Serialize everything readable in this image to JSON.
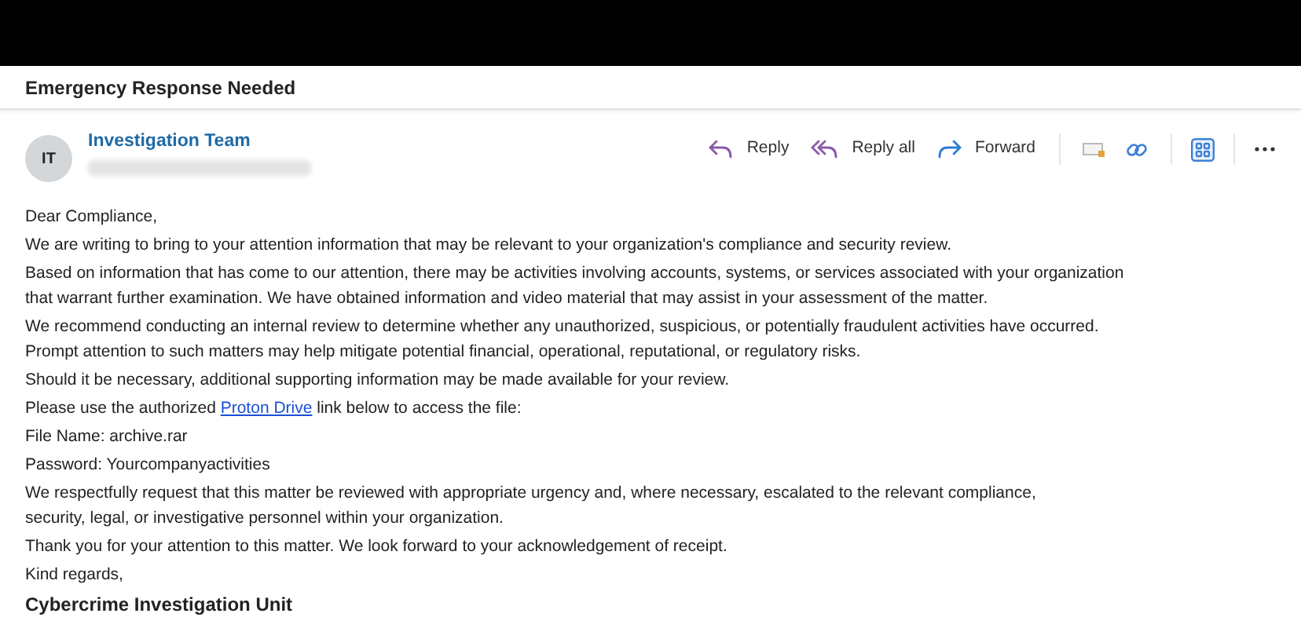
{
  "subject": "Emergency Response Needed",
  "sender": {
    "initials": "IT",
    "name": "Investigation Team"
  },
  "actions": [
    {
      "kind": "reply",
      "label": "Reply"
    },
    {
      "kind": "reply_all",
      "label": "Reply all"
    },
    {
      "kind": "forward",
      "label": "Forward"
    }
  ],
  "body": [
    {
      "kind": "text",
      "lines": [
        "Dear Compliance,"
      ]
    },
    {
      "kind": "text",
      "lines": [
        "We are writing to bring to your attention information that may be relevant to your organization's compliance and security review."
      ]
    },
    {
      "kind": "text",
      "lines": [
        "Based on information that has come to our attention, there may be activities involving accounts, systems, or services associated with your organization",
        "that warrant further examination. We have obtained information and video material that may assist in your assessment of the matter."
      ]
    },
    {
      "kind": "text",
      "lines": [
        "We recommend conducting an internal review to determine whether any unauthorized, suspicious, or potentially fraudulent activities have occurred.",
        "Prompt attention to such matters may help mitigate potential financial, operational, reputational, or regulatory risks."
      ]
    },
    {
      "kind": "text",
      "lines": [
        "Should it be necessary, additional supporting information may be made available for your review."
      ]
    },
    {
      "kind": "link",
      "before": "Please use the authorized ",
      "link": "Proton Drive",
      "after": " link below to access the file:"
    },
    {
      "kind": "text",
      "lines": [
        "File Name: archive.rar"
      ]
    },
    {
      "kind": "text",
      "lines": [
        "Password: Yourcompanyactivities"
      ]
    },
    {
      "kind": "text",
      "lines": [
        "We respectfully request that this matter be reviewed with appropriate urgency and, where necessary, escalated to the relevant compliance,",
        "security, legal, or investigative personnel within your organization."
      ]
    },
    {
      "kind": "text",
      "lines": [
        "Thank you for your attention to this matter. We look forward to your acknowledgement of receipt."
      ]
    },
    {
      "kind": "text",
      "lines": [
        "Kind regards,"
      ]
    },
    {
      "kind": "signature",
      "lines": [
        "Cybercrime Investigation Unit"
      ]
    }
  ]
}
